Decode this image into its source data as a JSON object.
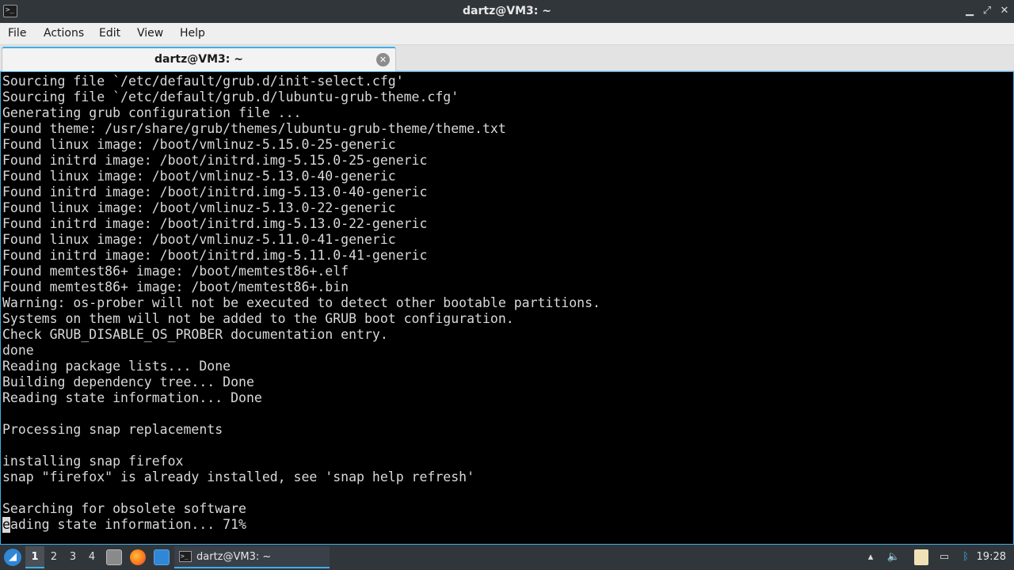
{
  "window": {
    "title": "dartz@VM3: ~",
    "icon": "terminal-icon",
    "controls": {
      "minimize": "▁",
      "restore": "⤢",
      "close": "✕"
    }
  },
  "menu": {
    "items": [
      {
        "label": "File"
      },
      {
        "label": "Actions"
      },
      {
        "label": "Edit"
      },
      {
        "label": "View"
      },
      {
        "label": "Help"
      }
    ]
  },
  "tabs": [
    {
      "label": "dartz@VM3: ~",
      "active": true
    }
  ],
  "terminal": {
    "lines": [
      "Sourcing file `/etc/default/grub.d/init-select.cfg'",
      "Sourcing file `/etc/default/grub.d/lubuntu-grub-theme.cfg'",
      "Generating grub configuration file ...",
      "Found theme: /usr/share/grub/themes/lubuntu-grub-theme/theme.txt",
      "Found linux image: /boot/vmlinuz-5.15.0-25-generic",
      "Found initrd image: /boot/initrd.img-5.15.0-25-generic",
      "Found linux image: /boot/vmlinuz-5.13.0-40-generic",
      "Found initrd image: /boot/initrd.img-5.13.0-40-generic",
      "Found linux image: /boot/vmlinuz-5.13.0-22-generic",
      "Found initrd image: /boot/initrd.img-5.13.0-22-generic",
      "Found linux image: /boot/vmlinuz-5.11.0-41-generic",
      "Found initrd image: /boot/initrd.img-5.11.0-41-generic",
      "Found memtest86+ image: /boot/memtest86+.elf",
      "Found memtest86+ image: /boot/memtest86+.bin",
      "Warning: os-prober will not be executed to detect other bootable partitions.",
      "Systems on them will not be added to the GRUB boot configuration.",
      "Check GRUB_DISABLE_OS_PROBER documentation entry.",
      "done",
      "Reading package lists... Done",
      "Building dependency tree... Done",
      "Reading state information... Done",
      "",
      "Processing snap replacements",
      "",
      "installing snap firefox",
      "snap \"firefox\" is already installed, see 'snap help refresh'",
      "",
      "Searching for obsolete software"
    ],
    "cursor_char": "e",
    "last_line_rest": "ading state information... 71%"
  },
  "taskbar": {
    "workspaces": [
      "1",
      "2",
      "3",
      "4"
    ],
    "active_workspace": "1",
    "task_label": "dartz@VM3: ~",
    "clock": "19:28",
    "tray_icons": [
      "panel-arrow-icon",
      "volume-icon",
      "clipboard-icon",
      "network-icon",
      "bluetooth-icon"
    ]
  }
}
